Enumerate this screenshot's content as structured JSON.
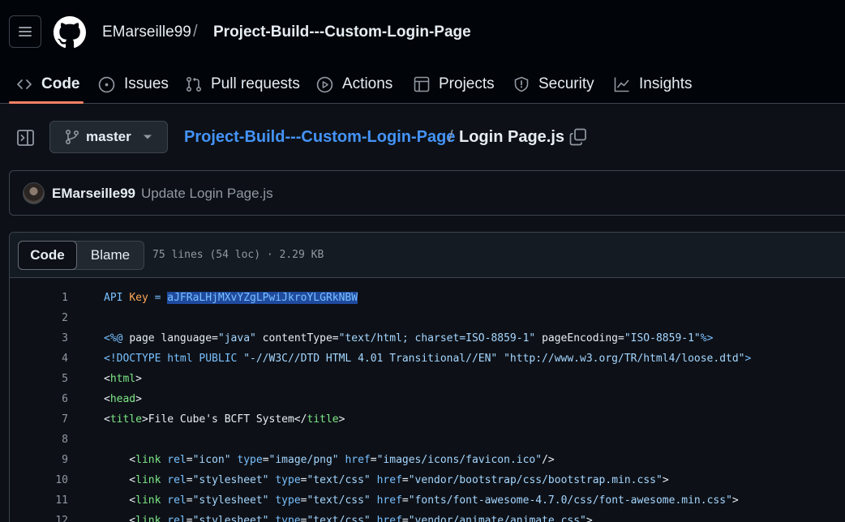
{
  "header": {
    "owner": "EMarseille99",
    "separator": "/",
    "repo": "Project-Build---Custom-Login-Page"
  },
  "tabs": [
    {
      "label": "Code",
      "icon": "code-icon",
      "active": true
    },
    {
      "label": "Issues",
      "icon": "issue-opened-icon"
    },
    {
      "label": "Pull requests",
      "icon": "git-pull-request-icon"
    },
    {
      "label": "Actions",
      "icon": "play-icon"
    },
    {
      "label": "Projects",
      "icon": "table-icon"
    },
    {
      "label": "Security",
      "icon": "shield-icon"
    },
    {
      "label": "Insights",
      "icon": "graph-icon"
    }
  ],
  "file_nav": {
    "branch": "master",
    "path_repo": "Project-Build---Custom-Login-Page",
    "path_sep": "/",
    "path_file": "Login Page.js"
  },
  "commit": {
    "author": "EMarseille99",
    "message": "Update Login Page.js"
  },
  "code_view": {
    "code_label": "Code",
    "blame_label": "Blame",
    "meta": "75 lines (54 loc) · 2.29 KB"
  },
  "lines": [
    {
      "n": "1",
      "tokens": [
        [
          "t-attr",
          "API "
        ],
        [
          "t-var",
          "Key"
        ],
        [
          "t-attr",
          " = "
        ],
        [
          "sel",
          "aJFRaLHjMXvYZgLPwiJkroYLGRkNBW"
        ]
      ]
    },
    {
      "n": "2",
      "tokens": []
    },
    {
      "n": "3",
      "tokens": [
        [
          "t-attr",
          "<%@ "
        ],
        [
          "t-plain",
          "page language="
        ],
        [
          "t-str",
          "\"java\""
        ],
        [
          "t-plain",
          " contentType="
        ],
        [
          "t-str",
          "\"text/html; charset=ISO-8859-1\""
        ],
        [
          "t-plain",
          " pageEncoding="
        ],
        [
          "t-str",
          "\"ISO-8859-1\""
        ],
        [
          "t-attr",
          "%>"
        ]
      ]
    },
    {
      "n": "4",
      "tokens": [
        [
          "t-attr",
          "<!DOCTYPE html PUBLIC "
        ],
        [
          "t-str",
          "\"-//W3C//DTD HTML 4.01 Transitional//EN\""
        ],
        [
          "t-plain",
          " "
        ],
        [
          "t-str",
          "\"http://www.w3.org/TR/html4/loose.dtd\""
        ],
        [
          "t-attr",
          ">"
        ]
      ]
    },
    {
      "n": "5",
      "tokens": [
        [
          "t-plain",
          "<"
        ],
        [
          "t-tag",
          "html"
        ],
        [
          "t-plain",
          ">"
        ]
      ]
    },
    {
      "n": "6",
      "tokens": [
        [
          "t-plain",
          "<"
        ],
        [
          "t-tag",
          "head"
        ],
        [
          "t-plain",
          ">"
        ]
      ]
    },
    {
      "n": "7",
      "tokens": [
        [
          "t-plain",
          "<"
        ],
        [
          "t-tag",
          "title"
        ],
        [
          "t-plain",
          ">File Cube's BCFT System</"
        ],
        [
          "t-tag",
          "title"
        ],
        [
          "t-plain",
          ">"
        ]
      ]
    },
    {
      "n": "8",
      "tokens": []
    },
    {
      "n": "9",
      "tokens": [
        [
          "t-plain",
          "    <"
        ],
        [
          "t-tag",
          "link"
        ],
        [
          "t-plain",
          " "
        ],
        [
          "t-attr",
          "rel"
        ],
        [
          "t-plain",
          "="
        ],
        [
          "t-str",
          "\"icon\""
        ],
        [
          "t-plain",
          " "
        ],
        [
          "t-attr",
          "type"
        ],
        [
          "t-plain",
          "="
        ],
        [
          "t-str",
          "\"image/png\""
        ],
        [
          "t-plain",
          " "
        ],
        [
          "t-attr",
          "href"
        ],
        [
          "t-plain",
          "="
        ],
        [
          "t-str",
          "\"images/icons/favicon.ico\""
        ],
        [
          "t-plain",
          "/>"
        ]
      ]
    },
    {
      "n": "10",
      "tokens": [
        [
          "t-plain",
          "    <"
        ],
        [
          "t-tag",
          "link"
        ],
        [
          "t-plain",
          " "
        ],
        [
          "t-attr",
          "rel"
        ],
        [
          "t-plain",
          "="
        ],
        [
          "t-str",
          "\"stylesheet\""
        ],
        [
          "t-plain",
          " "
        ],
        [
          "t-attr",
          "type"
        ],
        [
          "t-plain",
          "="
        ],
        [
          "t-str",
          "\"text/css\""
        ],
        [
          "t-plain",
          " "
        ],
        [
          "t-attr",
          "href"
        ],
        [
          "t-plain",
          "="
        ],
        [
          "t-str",
          "\"vendor/bootstrap/css/bootstrap.min.css\""
        ],
        [
          "t-plain",
          ">"
        ]
      ]
    },
    {
      "n": "11",
      "tokens": [
        [
          "t-plain",
          "    <"
        ],
        [
          "t-tag",
          "link"
        ],
        [
          "t-plain",
          " "
        ],
        [
          "t-attr",
          "rel"
        ],
        [
          "t-plain",
          "="
        ],
        [
          "t-str",
          "\"stylesheet\""
        ],
        [
          "t-plain",
          " "
        ],
        [
          "t-attr",
          "type"
        ],
        [
          "t-plain",
          "="
        ],
        [
          "t-str",
          "\"text/css\""
        ],
        [
          "t-plain",
          " "
        ],
        [
          "t-attr",
          "href"
        ],
        [
          "t-plain",
          "="
        ],
        [
          "t-str",
          "\"fonts/font-awesome-4.7.0/css/font-awesome.min.css\""
        ],
        [
          "t-plain",
          ">"
        ]
      ]
    },
    {
      "n": "12",
      "tokens": [
        [
          "t-plain",
          "    <"
        ],
        [
          "t-tag",
          "link"
        ],
        [
          "t-plain",
          " "
        ],
        [
          "t-attr",
          "rel"
        ],
        [
          "t-plain",
          "="
        ],
        [
          "t-str",
          "\"stylesheet\""
        ],
        [
          "t-plain",
          " "
        ],
        [
          "t-attr",
          "type"
        ],
        [
          "t-plain",
          "="
        ],
        [
          "t-str",
          "\"text/css\""
        ],
        [
          "t-plain",
          " "
        ],
        [
          "t-attr",
          "href"
        ],
        [
          "t-plain",
          "="
        ],
        [
          "t-str",
          "\"vendor/animate/animate.css\""
        ],
        [
          "t-plain",
          ">"
        ]
      ]
    }
  ]
}
